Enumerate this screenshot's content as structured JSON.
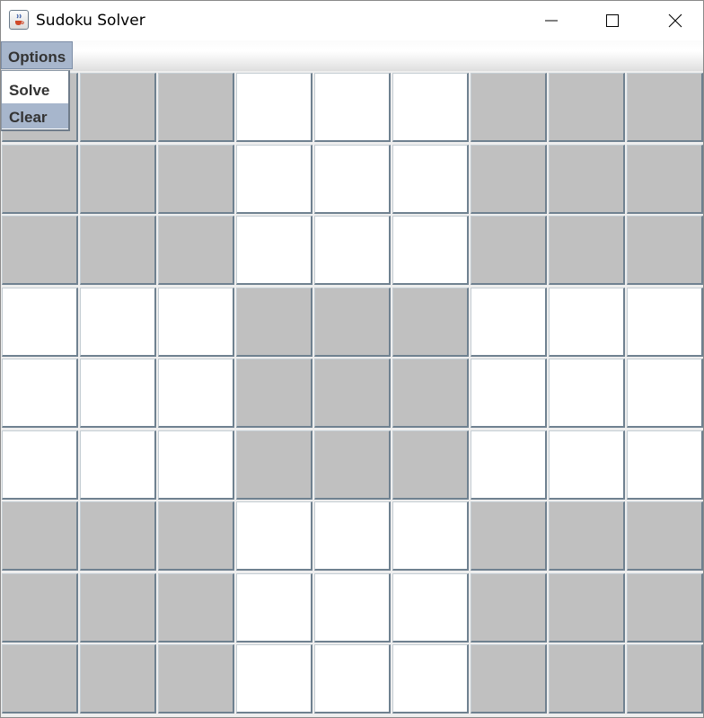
{
  "window": {
    "title": "Sudoku Solver",
    "icon": "java-cup-icon",
    "controls": [
      "minimize-icon",
      "maximize-icon",
      "close-icon"
    ]
  },
  "menubar": {
    "options_label": "Options"
  },
  "dropdown": {
    "items": [
      {
        "label": "Solve",
        "highlighted": false
      },
      {
        "label": "Clear",
        "highlighted": true
      }
    ]
  },
  "grid": {
    "rows": 9,
    "cols": 9,
    "values": [
      [
        "",
        "",
        "",
        "",
        "",
        "",
        "",
        "",
        ""
      ],
      [
        "",
        "",
        "",
        "",
        "",
        "",
        "",
        "",
        ""
      ],
      [
        "",
        "",
        "",
        "",
        "",
        "",
        "",
        "",
        ""
      ],
      [
        "",
        "",
        "",
        "",
        "",
        "",
        "",
        "",
        ""
      ],
      [
        "",
        "",
        "",
        "",
        "",
        "",
        "",
        "",
        ""
      ],
      [
        "",
        "",
        "",
        "",
        "",
        "",
        "",
        "",
        ""
      ],
      [
        "",
        "",
        "",
        "",
        "",
        "",
        "",
        "",
        ""
      ],
      [
        "",
        "",
        "",
        "",
        "",
        "",
        "",
        "",
        ""
      ],
      [
        "",
        "",
        "",
        "",
        "",
        "",
        "",
        "",
        ""
      ]
    ],
    "shaded_box_pattern": [
      [
        true,
        false,
        true
      ],
      [
        false,
        true,
        false
      ],
      [
        true,
        false,
        true
      ]
    ]
  },
  "colors": {
    "shaded_cell": "#c0c0c0",
    "plain_cell": "#ffffff",
    "menu_highlight": "#a7b6cc"
  }
}
